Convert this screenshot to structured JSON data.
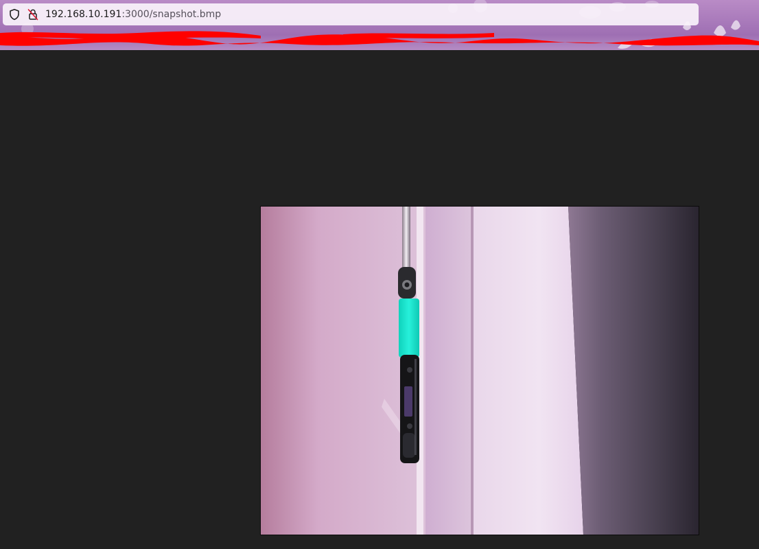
{
  "browser": {
    "url_host": "192.168.10.191",
    "url_path": ":3000/snapshot.bmp",
    "icons": [
      "shield-icon",
      "insecure-lock-icon"
    ]
  },
  "page": {
    "background_color": "#212121",
    "image": {
      "description": "camera snapshot",
      "format": "bmp"
    }
  },
  "colors": {
    "theme_purple": "#a879ba",
    "redaction_red": "#ff0000",
    "tool_cyan": "#19e3cc"
  }
}
